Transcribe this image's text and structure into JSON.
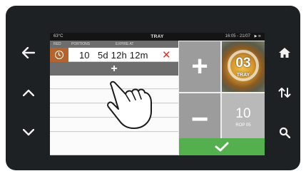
{
  "status_bar": {
    "temperature": "63°C",
    "title": "TRAY",
    "datetime": "16:05 - 21/07",
    "status_symbols": "▶ ≋"
  },
  "list": {
    "header": {
      "col1": "RED",
      "col2": "PORTIONS",
      "col3": "EXPIRE AT"
    },
    "active_row": {
      "icon": "clock-icon",
      "portions": "10",
      "expire": "5d 12h 12m",
      "delete_icon": "close-icon"
    },
    "add_label": "+"
  },
  "controls": {
    "plus_label": "+",
    "minus_label": "−",
    "tray_number": "03",
    "tray_label": "TRAY",
    "rop_number": "10",
    "rop_label": "ROP 05",
    "confirm_icon": "check-icon"
  },
  "side_buttons": {
    "left": [
      "back-arrow-icon",
      "chevron-up-icon",
      "chevron-down-icon"
    ],
    "right": [
      "home-icon",
      "sort-icon",
      "search-icon"
    ]
  },
  "colors": {
    "bezel": "#1e2124",
    "header": "#6d6d6d",
    "badge": "#b5642d",
    "delete": "#e0312d",
    "tile": "#9c9c9c",
    "confirm": "#54b04f"
  }
}
